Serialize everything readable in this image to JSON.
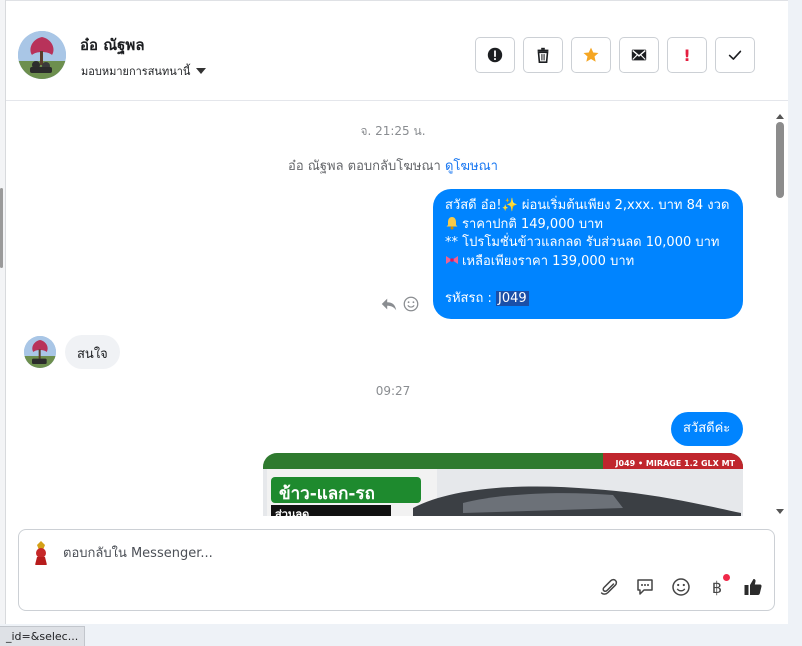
{
  "header": {
    "contact_name": "อ๋อ ณัฐพล",
    "assign_label": "มอบหมายการสนทนานี้",
    "actions": [
      {
        "name": "report-button",
        "icon": "exclamation-circle-icon"
      },
      {
        "name": "delete-button",
        "icon": "trash-icon"
      },
      {
        "name": "star-button",
        "icon": "star-icon",
        "color": "#f5a623"
      },
      {
        "name": "mark-unread-button",
        "icon": "envelope-icon"
      },
      {
        "name": "follow-up-button",
        "icon": "exclamation-icon",
        "label": "!",
        "color": "#e41e3f"
      },
      {
        "name": "done-button",
        "icon": "checkmark-icon"
      }
    ]
  },
  "chat": {
    "timestamp_1": "จ. 21:25 น.",
    "ad_reply_text": "อ๋อ ณัฐพล ตอบกลับโฆษณา",
    "ad_reply_link": "ดูโฆษณา",
    "outgoing_message_1": {
      "line1": "สวัสดี อ๋อ!✨  ผ่อนเริ่มต้นเพียง 2,xxx. บาท 84 งวด",
      "line2": "ราคาปกติ 149,000 บาท",
      "line3": "** โปรโมชั่นข้าวแลกลด รับส่วนลด 10,000 บาท",
      "line4": "เหลือเพียงราคา 139,000 บาท",
      "code_label": "รหัสรถ : ",
      "code_value": "J049"
    },
    "incoming_message_1": "สนใจ",
    "timestamp_2": "09:27",
    "outgoing_message_2": "สวัสดีค่ะ",
    "car_image_caption": "J049 • MIRAGE 1.2 GLX MT",
    "car_image_banner": "ข้าว-แลก-รถ",
    "car_image_sub": "ส่วนลด"
  },
  "composer": {
    "placeholder": "ตอบกลับใน Messenger...",
    "tools": [
      "paperclip-icon",
      "saved-reply-icon",
      "emoji-icon",
      "baht-icon",
      "thumbs-up-icon"
    ],
    "baht_symbol": "฿"
  },
  "statusbar": {
    "text": "_id=&selec..."
  },
  "colors": {
    "brand_blue": "#0084ff",
    "link_blue": "#1877f2",
    "incoming_bg": "#f0f2f5",
    "alert_red": "#e41e3f",
    "star_orange": "#f5a623"
  }
}
